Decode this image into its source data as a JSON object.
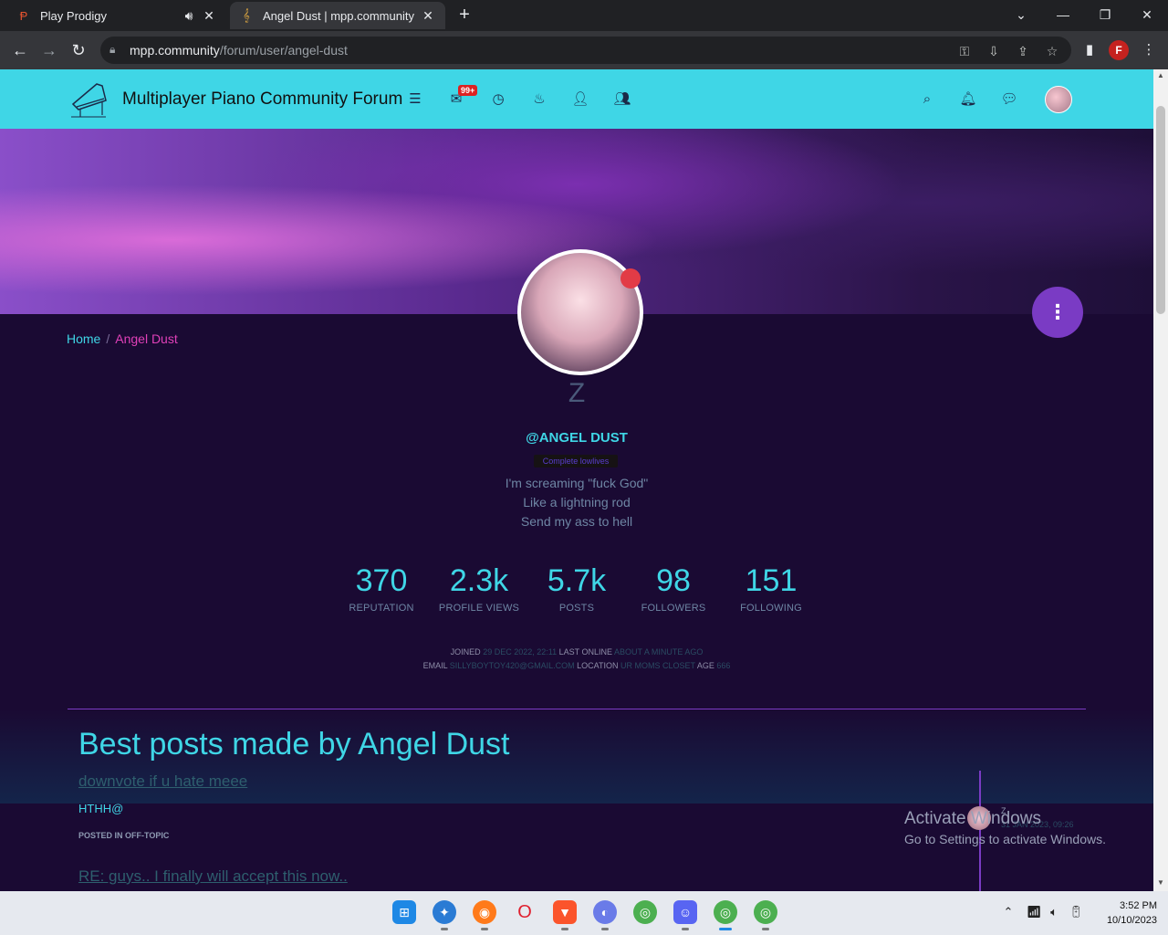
{
  "browser": {
    "tabs": [
      {
        "title": "Play Prodigy",
        "favicon": "prodigy-icon",
        "audio_icon": "speaker-icon"
      },
      {
        "title": "Angel Dust | mpp.community",
        "favicon": "treble-clef-icon"
      }
    ],
    "url_domain": "mpp.community",
    "url_path": "/forum/user/angel-dust",
    "profile_initial": "F"
  },
  "site": {
    "title": "Multiplayer Piano Community Forum",
    "notification_badge": "99+"
  },
  "breadcrumb": {
    "home": "Home",
    "separator": "/",
    "current": "Angel Dust"
  },
  "profile": {
    "display_initial": "Z",
    "handle": "@ANGEL DUST",
    "group_label": "Complete lowlives",
    "bio": [
      "I'm screaming \"fuck God\"",
      "Like a lightning rod",
      "Send my ass to hell"
    ],
    "stats": [
      {
        "value": "370",
        "label": "REPUTATION"
      },
      {
        "value": "2.3k",
        "label": "PROFILE VIEWS"
      },
      {
        "value": "5.7k",
        "label": "POSTS"
      },
      {
        "value": "98",
        "label": "FOLLOWERS"
      },
      {
        "value": "151",
        "label": "FOLLOWING"
      }
    ],
    "meta": {
      "joined_label": "JOINED",
      "joined": "29 DEC 2022, 22:11",
      "last_online_label": "LAST ONLINE",
      "last_online": "ABOUT A MINUTE AGO",
      "email_label": "EMAIL",
      "email": "SILLYBOYTOY420@GMAIL.COM",
      "location_label": "LOCATION",
      "location": "UR MOMS CLOSET",
      "age_label": "AGE",
      "age": "666"
    }
  },
  "best_posts": {
    "title": "Best posts made by Angel Dust",
    "posts": [
      {
        "title": "downvote if u hate meee",
        "body": "HTHH@",
        "posted_in": "POSTED IN OFF-TOPIC",
        "user": "Z",
        "date": "31 JAN 2023, 09:26"
      },
      {
        "title": "RE: guys.. I finally will accept this now.."
      }
    ]
  },
  "watermark": {
    "line1": "Activate Windows",
    "line2": "Go to Settings to activate Windows."
  },
  "clock": {
    "time": "3:52 PM",
    "date": "10/10/2023"
  },
  "colors": {
    "accent": "#3fd6e6",
    "purple": "#7a3bc4",
    "pink": "#e040b8"
  }
}
